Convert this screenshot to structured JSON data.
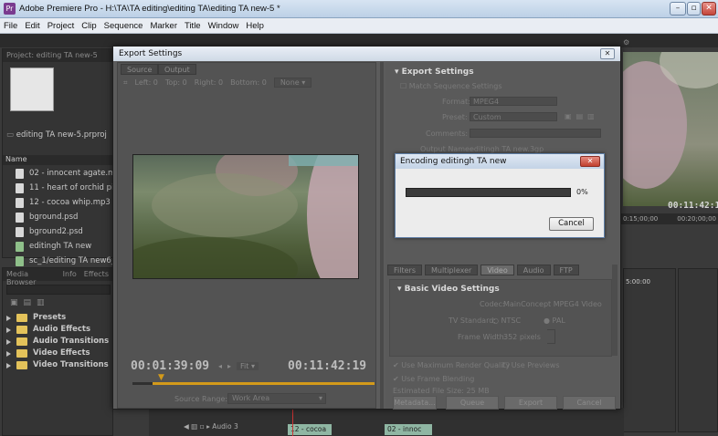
{
  "window": {
    "title": "Adobe Premiere Pro - H:\\TA\\TA editing\\editing TA\\editing TA new-5 *",
    "controls": [
      "–",
      "▫",
      "✕"
    ]
  },
  "menu": [
    "File",
    "Edit",
    "Project",
    "Clip",
    "Sequence",
    "Marker",
    "Title",
    "Window",
    "Help"
  ],
  "project_panel": {
    "tab": "Project: editing TA new-5",
    "project_file": "editing TA new-5.prproj",
    "column_name": "Name",
    "items": [
      {
        "name": "02 - innocent agate.mp3",
        "icon": "audio-file-icon"
      },
      {
        "name": "11 - heart of orchid pink",
        "icon": "audio-file-icon"
      },
      {
        "name": "12 - cocoa whip.mp3",
        "icon": "audio-file-icon"
      },
      {
        "name": "bground.psd",
        "icon": "image-file-icon"
      },
      {
        "name": "bground2.psd",
        "icon": "image-file-icon"
      },
      {
        "name": "editingh TA new",
        "icon": "sequence-icon"
      },
      {
        "name": "sc_1/editing TA new6_2",
        "icon": "sequence-icon"
      }
    ]
  },
  "effects_panel": {
    "tabs": [
      "Media Browser",
      "Info",
      "Effects"
    ],
    "items": [
      "Presets",
      "Audio Effects",
      "Audio Transitions",
      "Video Effects",
      "Video Transitions"
    ]
  },
  "export_dialog": {
    "title": "Export Settings",
    "close": "✕",
    "source_tabs": [
      "Source",
      "Output"
    ],
    "crop_bar": {
      "left": "Left: 0",
      "top": "Top: 0",
      "right": "Right: 0",
      "bottom": "Bottom: 0",
      "preset": "None"
    },
    "timecode_in": "00:01:39:09",
    "fit": "Fit",
    "timecode_out": "00:11:42:19",
    "source_range_label": "Source Range:",
    "source_range_value": "Work Area",
    "settings": {
      "header": "Export Settings",
      "match_sequence": "Match Sequence Settings",
      "format_label": "Format:",
      "format_value": "MPEG4",
      "preset_label": "Preset:",
      "preset_value": "Custom",
      "comments_label": "Comments:",
      "output_name_label": "Output Name:",
      "output_name_value": "editingh TA new.3gp"
    },
    "setting_tabs": [
      "Filters",
      "Multiplexer",
      "Video",
      "Audio",
      "FTP"
    ],
    "basic_video": {
      "header": "Basic Video Settings",
      "codec_label": "Codec:",
      "codec_value": "MainConcept MPEG4 Video",
      "tv_standard_label": "TV Standard:",
      "ntsc": "NTSC",
      "pal": "PAL",
      "frame_width_label": "Frame Width:",
      "frame_width_value": "352 pixels"
    },
    "use_max_render": "Use Maximum Render Quality",
    "use_previews": "Use Previews",
    "use_frame_blending": "Use Frame Blending",
    "estimated_size": "Estimated File Size: 25 MB",
    "buttons": [
      "Metadata...",
      "Queue",
      "Export",
      "Cancel"
    ]
  },
  "encoding_popup": {
    "title": "Encoding editingh TA new",
    "close": "✕",
    "progress": 0,
    "percent_label": "0%",
    "cancel": "Cancel"
  },
  "program_monitor": {
    "timecode": "00:11:42:19",
    "ruler": [
      "0:15;00;00",
      "00:20;00;00"
    ],
    "ruler2": "5:00:00"
  },
  "timeline": {
    "audio_track": "Audio 3",
    "clips": [
      "12 - cocoa",
      "02 - innoc"
    ]
  },
  "colors": {
    "accent_orange": "#d39a1a",
    "window_chrome": "#cfd9e6",
    "close_red": "#c4453a"
  }
}
